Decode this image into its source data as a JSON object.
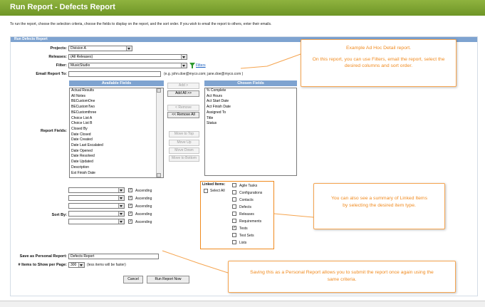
{
  "header": {
    "title": "Run Report - Defects Report"
  },
  "instructions": "To run the report, choose the selection criteria, choose the fields to display on the report, and the sort order.  If you wish to email the report to others, enter their emails.",
  "panel": {
    "title": "Run Defects Report"
  },
  "form": {
    "projects_label": "Projects:",
    "projects_value": "Division A",
    "releases_label": "Releases:",
    "releases_value": "(All Releases)",
    "filter_label": "Filter:",
    "filter_value": "MusicStudio",
    "filters_link": "Filters",
    "email_label": "Email Report To:",
    "email_value": "",
    "email_hint": "(e.g. john.doe@myco.com; jane.doe@myco.com )",
    "fields_label": "Report Fields:"
  },
  "available": {
    "title": "Available Fields",
    "items": [
      "Actual Results",
      "All Notes",
      "BECustomOne",
      "BECustomTwo",
      "BECustomthree",
      "Choice List A",
      "Choice List B",
      "Closed By",
      "Date Closed",
      "Date Created",
      "Date Last Escalated",
      "Date Opened",
      "Date Resolved",
      "Date Updated",
      "Description",
      "Est Finish Date"
    ]
  },
  "chosen": {
    "title": "Chosen Fields",
    "items": [
      "% Complete",
      "Act Hours",
      "Act Start Date",
      "Act Finish Date",
      "Assigned To",
      "Title",
      "Status"
    ]
  },
  "buttons": {
    "add": "Add >",
    "add_all": "Add All >>",
    "remove": "< Remove",
    "remove_all": "<< Remove All",
    "move_top": "Move to Top",
    "move_up": "Move Up",
    "move_down": "Move Down",
    "move_bottom": "Move to Bottom",
    "cancel": "Cancel",
    "run": "Run Report Now"
  },
  "sort": {
    "label": "Sort By:",
    "rows": [
      {
        "field": "",
        "checked": true,
        "order": "Ascending"
      },
      {
        "field": "",
        "checked": true,
        "order": "Ascending"
      },
      {
        "field": "",
        "checked": true,
        "order": "Ascending"
      },
      {
        "field": "",
        "checked": true,
        "order": "Ascending"
      },
      {
        "field": "",
        "checked": true,
        "order": "Ascending"
      }
    ]
  },
  "linked": {
    "label": "Linked Items:",
    "select_all": "Select All",
    "items": [
      {
        "label": "Agile Tasks",
        "checked": false
      },
      {
        "label": "Configurations",
        "checked": false
      },
      {
        "label": "Contacts",
        "checked": false
      },
      {
        "label": "Defects",
        "checked": false
      },
      {
        "label": "Releases",
        "checked": false
      },
      {
        "label": "Requirements",
        "checked": false
      },
      {
        "label": "Tests",
        "checked": true
      },
      {
        "label": "Test Sets",
        "checked": false
      },
      {
        "label": "Lists",
        "checked": false
      }
    ]
  },
  "save": {
    "label": "Save as Personal Report:",
    "value": "Defects Report",
    "items_label": "# Items to Show per Page:",
    "items_value": "300",
    "items_hint": "(less items will be faster)"
  },
  "callouts": {
    "c1_title": "Example Ad Hoc Detail report.",
    "c1_body": "On this report, you can use Filters, email the report, select the desired columns and sort order.",
    "c2_body": "You can also see a summary of Linked Items by selecting the desired item type.",
    "c3_body": "Saving this as a Personal Report allows you to submit the report once again using the same criteria."
  },
  "colors": {
    "title_bar": "#7aa232",
    "section_header": "#7ea3d0",
    "callout_orange": "#f08a1e"
  }
}
